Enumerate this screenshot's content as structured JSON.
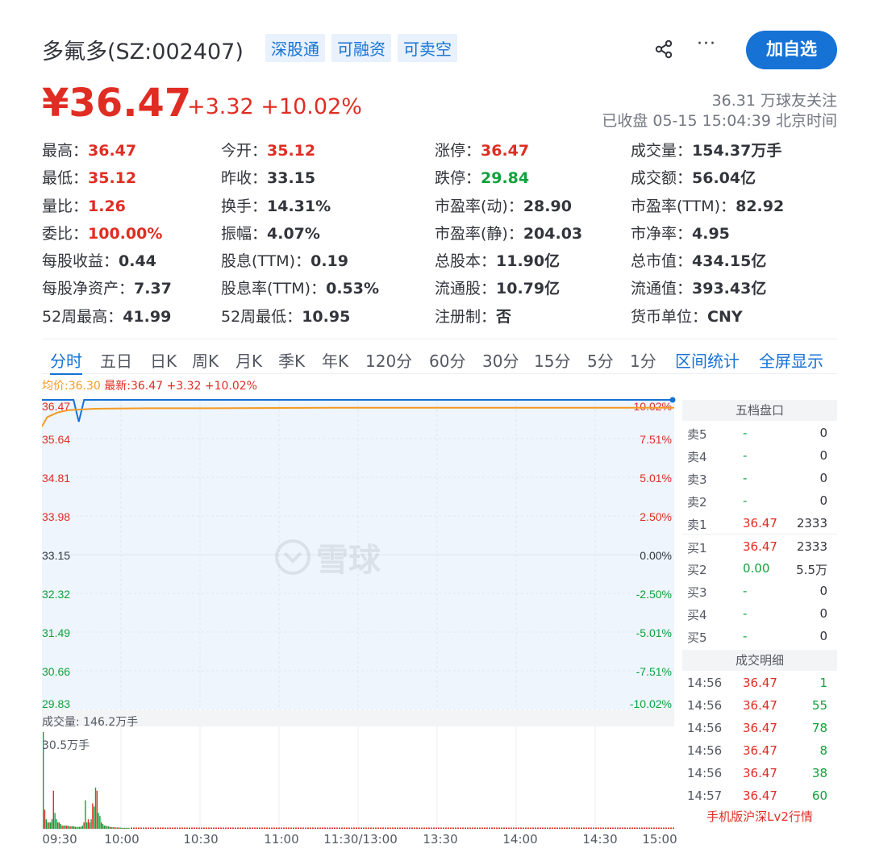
{
  "header": {
    "stock_name": "多氟多(SZ:002407)",
    "tags": [
      "深股通",
      "可融资",
      "可卖空"
    ],
    "share_icon": "share-icon",
    "more_icon": "more-icon",
    "more_text": "···",
    "follow_label": "加自选"
  },
  "price": {
    "current": "¥36.47",
    "change": "+3.32 +10.02%",
    "followers": "36.31 万球友关注",
    "status": "已收盘 05-15 15:04:39 北京时间"
  },
  "quote": [
    [
      {
        "label": "最高：",
        "value": "36.47",
        "color": "red"
      },
      {
        "label": "今开：",
        "value": "35.12",
        "color": "red"
      },
      {
        "label": "涨停：",
        "value": "36.47",
        "color": "red"
      },
      {
        "label": "成交量：",
        "value": "154.37万手",
        "color": ""
      }
    ],
    [
      {
        "label": "最低：",
        "value": "35.12",
        "color": "red"
      },
      {
        "label": "昨收：",
        "value": "33.15",
        "color": ""
      },
      {
        "label": "跌停：",
        "value": "29.84",
        "color": "green"
      },
      {
        "label": "成交额：",
        "value": "56.04亿",
        "color": ""
      }
    ],
    [
      {
        "label": "量比：",
        "value": "1.26",
        "color": "red"
      },
      {
        "label": "换手：",
        "value": "14.31%",
        "color": ""
      },
      {
        "label": "市盈率(动)：",
        "value": "28.90",
        "color": ""
      },
      {
        "label": "市盈率(TTM)：",
        "value": "82.92",
        "color": ""
      }
    ],
    [
      {
        "label": "委比：",
        "value": "100.00%",
        "color": "red"
      },
      {
        "label": "振幅：",
        "value": "4.07%",
        "color": ""
      },
      {
        "label": "市盈率(静)：",
        "value": "204.03",
        "color": ""
      },
      {
        "label": "市净率：",
        "value": "4.95",
        "color": ""
      }
    ],
    [
      {
        "label": "每股收益：",
        "value": "0.44",
        "color": ""
      },
      {
        "label": "股息(TTM)：",
        "value": "0.19",
        "color": ""
      },
      {
        "label": "总股本：",
        "value": "11.90亿",
        "color": ""
      },
      {
        "label": "总市值：",
        "value": "434.15亿",
        "color": ""
      }
    ],
    [
      {
        "label": "每股净资产：",
        "value": "7.37",
        "color": ""
      },
      {
        "label": "股息率(TTM)：",
        "value": "0.53%",
        "color": ""
      },
      {
        "label": "流通股：",
        "value": "10.79亿",
        "color": ""
      },
      {
        "label": "流通值：",
        "value": "393.43亿",
        "color": ""
      }
    ],
    [
      {
        "label": "52周最高：",
        "value": "41.99",
        "color": ""
      },
      {
        "label": "52周最低：",
        "value": "10.95",
        "color": ""
      },
      {
        "label": "注册制：",
        "value": "否",
        "color": ""
      },
      {
        "label": "货币单位：",
        "value": "CNY",
        "color": ""
      }
    ]
  ],
  "tabs": [
    "分时",
    "五日",
    "日K",
    "周K",
    "月K",
    "季K",
    "年K",
    "120分",
    "60分",
    "30分",
    "15分",
    "5分",
    "1分"
  ],
  "tab_links": [
    "区间统计",
    "全屏显示"
  ],
  "legend": {
    "avg": "均价:36.30",
    "latest": "最新:36.47 +3.32 +10.02%"
  },
  "chart_data": {
    "type": "line",
    "y_left_ticks": [
      "36.47",
      "35.64",
      "34.81",
      "33.98",
      "33.15",
      "32.32",
      "31.49",
      "30.66",
      "29.83"
    ],
    "y_right_ticks": [
      "10.02%",
      "7.51%",
      "5.01%",
      "2.50%",
      "0.00%",
      "-2.50%",
      "-5.01%",
      "-7.51%",
      "-10.02%"
    ],
    "x_ticks": [
      "09:30",
      "10:00",
      "10:30",
      "11:00",
      "11:30/13:00",
      "13:30",
      "14:00",
      "14:30",
      "15:00"
    ],
    "series": [
      {
        "name": "最新",
        "color": "#1672d5",
        "x": [
          0,
          12,
          14,
          16,
          18,
          240
        ],
        "y": [
          36.47,
          36.47,
          36.0,
          36.47,
          36.47,
          36.47
        ]
      },
      {
        "name": "均价",
        "color": "#f59a23",
        "x": [
          0,
          2,
          6,
          10,
          20,
          40,
          60,
          110,
          240
        ],
        "y": [
          35.9,
          36.1,
          36.2,
          36.25,
          36.28,
          36.29,
          36.29,
          36.3,
          36.3
        ]
      }
    ],
    "ylim": [
      29.83,
      36.47
    ],
    "volume": {
      "label": "成交量: 146.2万手",
      "max_label": "30.5万手",
      "max": 30.5,
      "bars": [
        30.5,
        6,
        3,
        2,
        2,
        2,
        3,
        12,
        5,
        3,
        2,
        2,
        1.5,
        1,
        1,
        1,
        1,
        1,
        0.8,
        0.8,
        0.8,
        0.8,
        0.6,
        0.6,
        0.6,
        0.6,
        0.6,
        1,
        2,
        9,
        2,
        3,
        2,
        3,
        8,
        7,
        13,
        12,
        5,
        4,
        2,
        1.5,
        1,
        1,
        0.8,
        0.8,
        0.6,
        0.5,
        0.5,
        0.5,
        0.4,
        0.4,
        0.4,
        0.4,
        0.3,
        0.3,
        0.3,
        0.3,
        0.3,
        0.3
      ]
    }
  },
  "orderbook": {
    "title": "五档盘口",
    "rows": [
      {
        "label": "卖5",
        "price": "-",
        "vol": "0",
        "color": "green"
      },
      {
        "label": "卖4",
        "price": "-",
        "vol": "0",
        "color": "green"
      },
      {
        "label": "卖3",
        "price": "-",
        "vol": "0",
        "color": "green"
      },
      {
        "label": "卖2",
        "price": "-",
        "vol": "0",
        "color": "green"
      },
      {
        "label": "卖1",
        "price": "36.47",
        "vol": "2333",
        "color": "red"
      },
      {
        "label": "买1",
        "price": "36.47",
        "vol": "2333",
        "color": "red"
      },
      {
        "label": "买2",
        "price": "0.00",
        "vol": "5.5万",
        "color": "green"
      },
      {
        "label": "买3",
        "price": "-",
        "vol": "0",
        "color": "green"
      },
      {
        "label": "买4",
        "price": "-",
        "vol": "0",
        "color": "green"
      },
      {
        "label": "买5",
        "price": "-",
        "vol": "0",
        "color": "green"
      }
    ],
    "trades_title": "成交明细",
    "trades": [
      {
        "time": "14:56",
        "price": "36.47",
        "vol": "1"
      },
      {
        "time": "14:56",
        "price": "36.47",
        "vol": "55"
      },
      {
        "time": "14:56",
        "price": "36.47",
        "vol": "78"
      },
      {
        "time": "14:56",
        "price": "36.47",
        "vol": "8"
      },
      {
        "time": "14:56",
        "price": "36.47",
        "vol": "38"
      },
      {
        "time": "14:57",
        "price": "36.47",
        "vol": "60"
      }
    ],
    "lv2_link": "手机版沪深Lv2行情"
  },
  "watermark": "雪球",
  "colors": {
    "red": "#e02d23",
    "green": "#10a23c",
    "blue": "#1672d5",
    "orange": "#f59a23"
  }
}
